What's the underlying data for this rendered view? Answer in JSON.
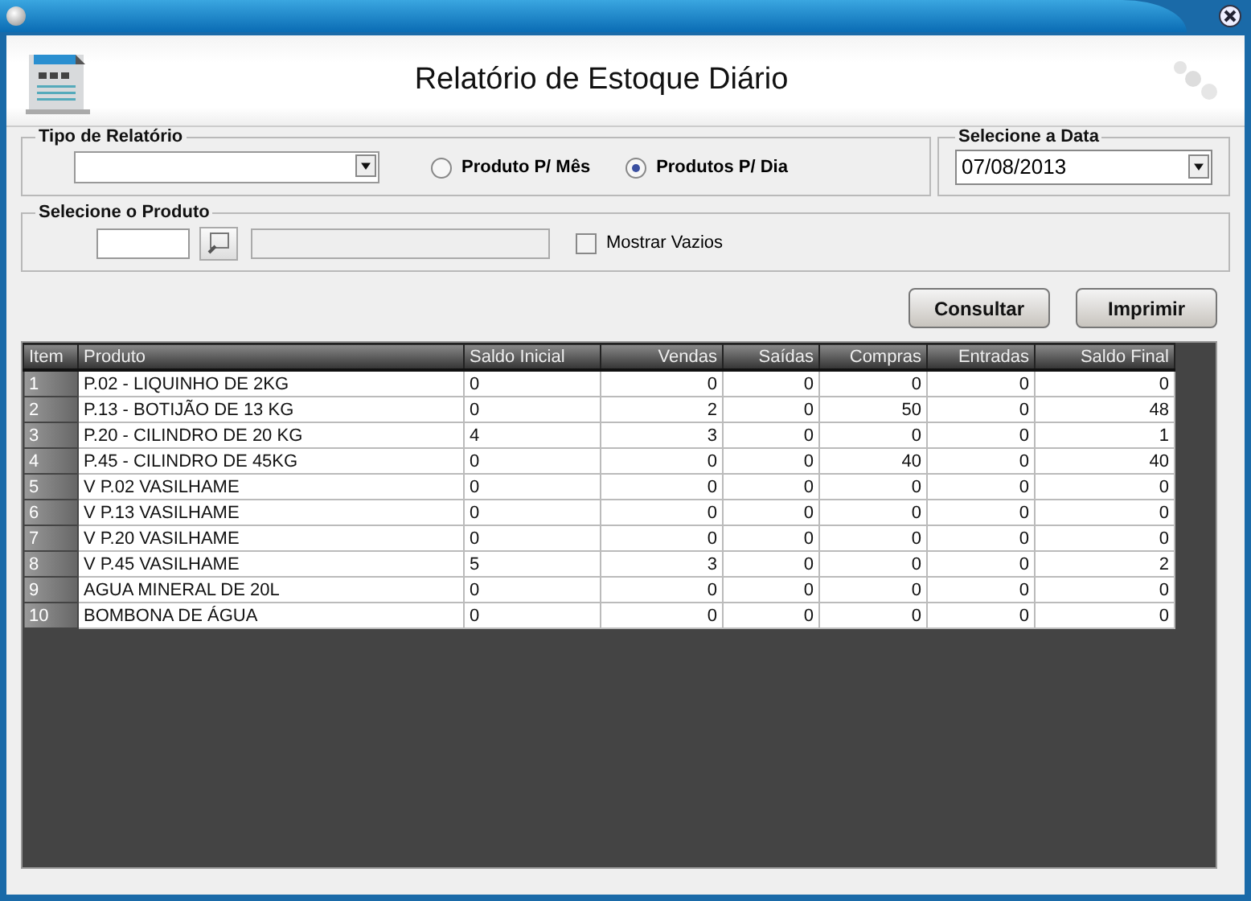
{
  "window": {
    "title": "Relatório de Estoque Diário"
  },
  "report_type": {
    "legend": "Tipo de Relatório",
    "options": [
      {
        "label": "Produto P/ Mês",
        "selected": false
      },
      {
        "label": "Produtos P/ Dia",
        "selected": true
      }
    ]
  },
  "date": {
    "legend": "Selecione a Data",
    "value": "07/08/2013"
  },
  "product": {
    "legend": "Selecione o Produto",
    "show_empty": {
      "label": "Mostrar Vazios",
      "checked": false
    }
  },
  "buttons": [
    "Consultar",
    "Imprimir"
  ],
  "table": {
    "columns": [
      {
        "label": "Item",
        "kind": "text"
      },
      {
        "label": "Produto",
        "kind": "text"
      },
      {
        "label": "Saldo Inicial",
        "kind": "text"
      },
      {
        "label": "Vendas",
        "kind": "number"
      },
      {
        "label": "Saídas",
        "kind": "number"
      },
      {
        "label": "Compras",
        "kind": "number"
      },
      {
        "label": "Entradas",
        "kind": "number"
      },
      {
        "label": "Saldo Final",
        "kind": "number"
      }
    ],
    "rows": [
      [
        "1",
        "P.02 - LIQUINHO DE 2KG",
        "0",
        "0",
        "0",
        "0",
        "0",
        "0"
      ],
      [
        "2",
        "P.13 - BOTIJÃO DE 13 KG",
        "0",
        "2",
        "0",
        "50",
        "0",
        "48"
      ],
      [
        "3",
        "P.20 - CILINDRO DE 20 KG",
        "4",
        "3",
        "0",
        "0",
        "0",
        "1"
      ],
      [
        "4",
        "P.45 - CILINDRO DE 45KG",
        "0",
        "0",
        "0",
        "40",
        "0",
        "40"
      ],
      [
        "5",
        "V P.02 VASILHAME",
        "0",
        "0",
        "0",
        "0",
        "0",
        "0"
      ],
      [
        "6",
        "V P.13 VASILHAME",
        "0",
        "0",
        "0",
        "0",
        "0",
        "0"
      ],
      [
        "7",
        "V P.20 VASILHAME",
        "0",
        "0",
        "0",
        "0",
        "0",
        "0"
      ],
      [
        "8",
        "V P.45 VASILHAME",
        "5",
        "3",
        "0",
        "0",
        "0",
        "2"
      ],
      [
        "9",
        "AGUA MINERAL DE 20L",
        "0",
        "0",
        "0",
        "0",
        "0",
        "0"
      ],
      [
        "10",
        "BOMBONA DE ÁGUA",
        "0",
        "0",
        "0",
        "0",
        "0",
        "0"
      ]
    ]
  }
}
